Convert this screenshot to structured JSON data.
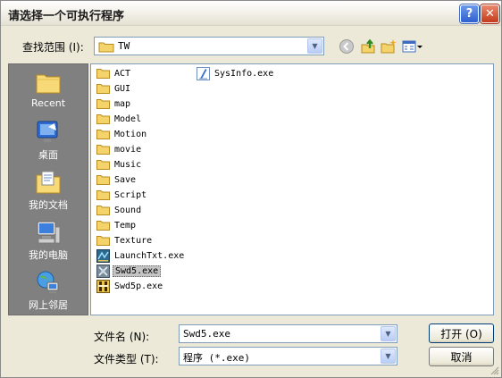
{
  "window": {
    "title": "请选择一个可执行程序"
  },
  "title_buttons": {
    "help": "?",
    "close": "✕"
  },
  "lookin": {
    "label": "查找范围 (I):",
    "value": "TW",
    "icon": "folder-icon"
  },
  "toolbar": [
    "back-icon",
    "up-folder-icon",
    "new-folder-icon",
    "view-menu-icon"
  ],
  "places": [
    {
      "label": "Recent",
      "icon": "recent-icon"
    },
    {
      "label": "桌面",
      "icon": "desktop-icon"
    },
    {
      "label": "我的文档",
      "icon": "my-documents-icon"
    },
    {
      "label": "我的电脑",
      "icon": "my-computer-icon"
    },
    {
      "label": "网上邻居",
      "icon": "network-icon"
    }
  ],
  "files": [
    {
      "name": "ACT",
      "type": "folder"
    },
    {
      "name": "GUI",
      "type": "folder"
    },
    {
      "name": "map",
      "type": "folder"
    },
    {
      "name": "Model",
      "type": "folder"
    },
    {
      "name": "Motion",
      "type": "folder"
    },
    {
      "name": "movie",
      "type": "folder"
    },
    {
      "name": "Music",
      "type": "folder"
    },
    {
      "name": "Save",
      "type": "folder"
    },
    {
      "name": "Script",
      "type": "folder"
    },
    {
      "name": "Sound",
      "type": "folder"
    },
    {
      "name": "Temp",
      "type": "folder"
    },
    {
      "name": "Texture",
      "type": "folder"
    },
    {
      "name": "LaunchTxt.exe",
      "type": "exe"
    },
    {
      "name": "Swd5.exe",
      "type": "exe",
      "selected": true
    },
    {
      "name": "Swd5p.exe",
      "type": "exe"
    },
    {
      "name": "SysInfo.exe",
      "type": "exe"
    }
  ],
  "filename": {
    "label": "文件名 (N):",
    "value": "Swd5.exe"
  },
  "filetype": {
    "label": "文件类型 (T):",
    "value": "程序 (*.exe)"
  },
  "buttons": {
    "open": "打开 (O)",
    "cancel": "取消"
  },
  "colors": {
    "places_bg": "#808080",
    "dialog_bg": "#ece9d8",
    "field_border": "#7f9db9",
    "folder": "#f5d36b"
  }
}
